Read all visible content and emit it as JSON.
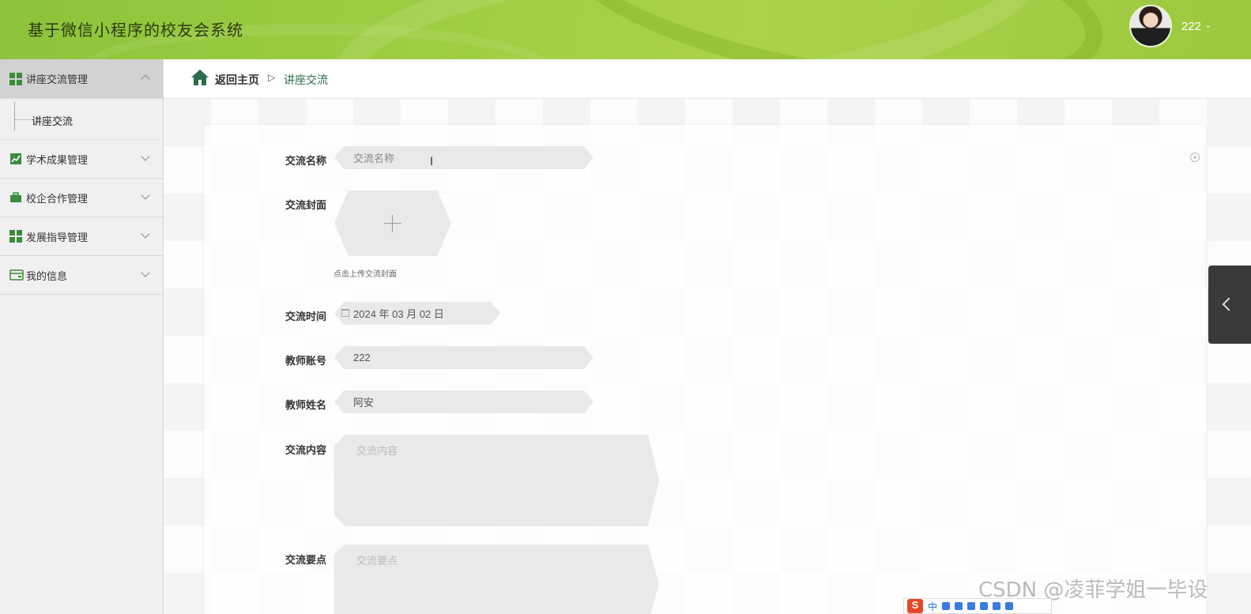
{
  "header": {
    "app_title": "基于微信小程序的校友会系统",
    "user_name": "222",
    "user_caret": "⌄"
  },
  "sidebar": {
    "groups": [
      {
        "label": "讲座交流管理",
        "icon": "grid-icon",
        "expanded": true,
        "items": [
          {
            "label": "讲座交流"
          }
        ]
      },
      {
        "label": "学术成果管理",
        "icon": "trend-chart-icon",
        "expanded": false
      },
      {
        "label": "校企合作管理",
        "icon": "briefcase-icon",
        "expanded": false
      },
      {
        "label": "发展指导管理",
        "icon": "grid-icon",
        "expanded": false
      },
      {
        "label": "我的信息",
        "icon": "id-card-icon",
        "expanded": false
      }
    ]
  },
  "breadcrumb": {
    "home": "返回主页",
    "separator": "▷",
    "current": "讲座交流"
  },
  "form": {
    "name": {
      "label": "交流名称",
      "placeholder": "交流名称"
    },
    "cover": {
      "label": "交流封面",
      "hint": "点击上传交流封面"
    },
    "time": {
      "label": "交流时间",
      "value": "2024 年 03 月 02 日"
    },
    "teacher_account": {
      "label": "教师账号",
      "value": "222"
    },
    "teacher_name": {
      "label": "教师姓名",
      "value": "阿安"
    },
    "content": {
      "label": "交流内容",
      "placeholder": "交流内容"
    },
    "points": {
      "label": "交流要点",
      "placeholder": "交流要点"
    }
  },
  "overlay": {
    "watermark": "CSDN @凌菲学姐一毕设",
    "ime_logo": "S",
    "ime_mode": "中"
  },
  "colors": {
    "header_green": "#9fcd42",
    "accent_green": "#3b8c3a",
    "breadcrumb_current": "#2e6b4a"
  }
}
